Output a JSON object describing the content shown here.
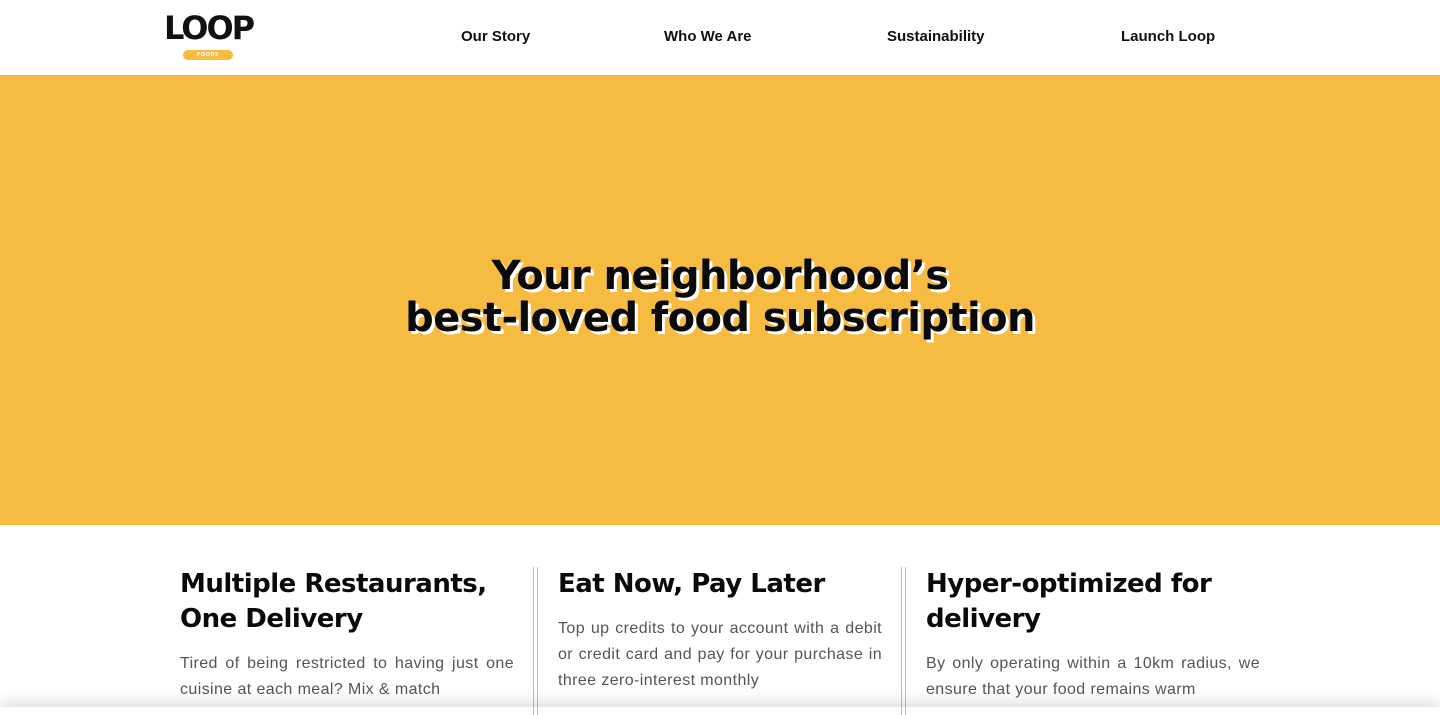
{
  "brand": {
    "logo_word": "LOOP",
    "logo_sub": "FOODS"
  },
  "nav": {
    "items": [
      {
        "label": "Our Story"
      },
      {
        "label": "Who We Are"
      },
      {
        "label": "Sustainability"
      },
      {
        "label": "Launch Loop"
      }
    ]
  },
  "hero": {
    "title_line1": "Your neighborhood’s",
    "title_line2": "best-loved food subscription"
  },
  "features": [
    {
      "title": "Multiple Restaurants, One Delivery",
      "text": "Tired of being restricted to having just one cuisine at each meal? Mix & match"
    },
    {
      "title": "Eat Now, Pay Later",
      "text": "Top up credits to your account with a debit or credit card and pay for your purchase in three zero-interest monthly"
    },
    {
      "title": "Hyper-optimized for delivery",
      "text": "By only operating within a 10km radius, we ensure that your food remains warm"
    }
  ],
  "colors": {
    "accent": "#f5bc41",
    "text": "#0a0a0a",
    "body_text": "#555555"
  }
}
